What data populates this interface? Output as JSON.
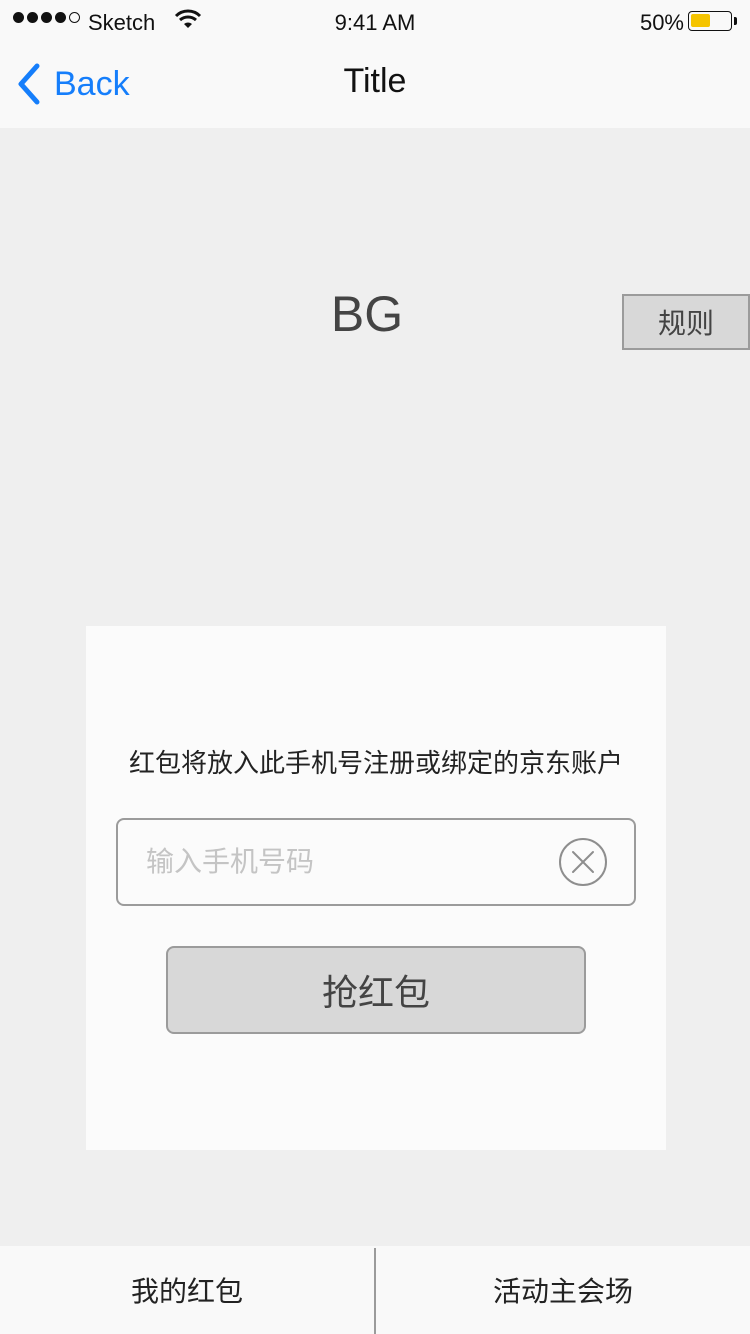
{
  "status_bar": {
    "carrier": "Sketch",
    "time": "9:41 AM",
    "battery_percent": "50%",
    "battery_level": 0.5,
    "signal_icon": "signal-dots-icon",
    "wifi_icon": "wifi-icon",
    "battery_icon": "battery-icon"
  },
  "nav": {
    "back_label": "Back",
    "back_icon": "chevron-left-icon",
    "title": "Title",
    "accent_color": "#157efb"
  },
  "banner": {
    "bg_label": "BG",
    "rules_label": "规则"
  },
  "card": {
    "message": "红包将放入此手机号注册或绑定的京东账户",
    "phone_input": {
      "value": "",
      "placeholder": "输入手机号码",
      "clear_icon": "clear-circle-icon"
    },
    "grab_button_label": "抢红包"
  },
  "bottom_tabs": [
    {
      "label": "我的红包"
    },
    {
      "label": "活动主会场"
    }
  ]
}
